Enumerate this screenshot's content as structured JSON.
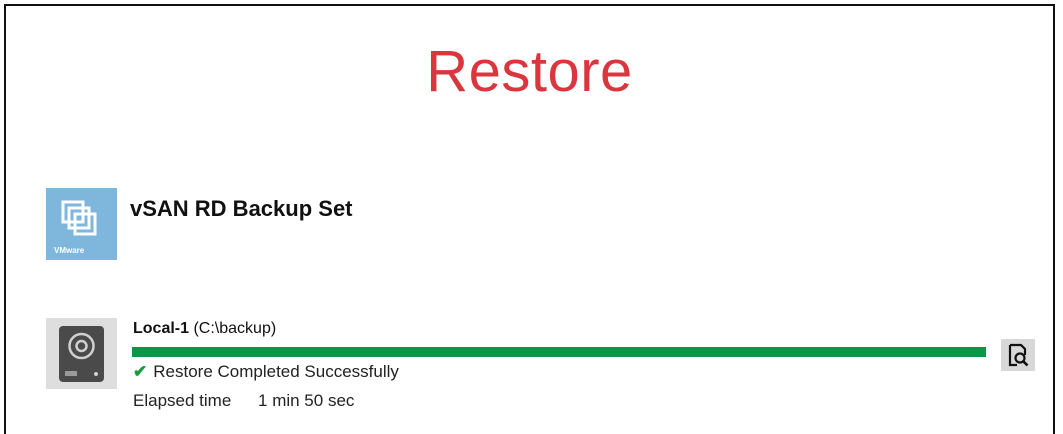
{
  "title": "Restore",
  "colors": {
    "title": "#d9363e",
    "progress": "#0a9644",
    "check": "#1a9a3a",
    "vmware_icon": "#7fb6dc"
  },
  "backup_set": {
    "icon": "vmware-icon",
    "icon_caption": "VMware",
    "name": "vSAN RD Backup Set"
  },
  "destination": {
    "icon": "hard-drive-icon",
    "name": "Local-1",
    "path": "(C:\\backup)",
    "progress": 1.0,
    "status_icon": "check-icon",
    "status": "Restore Completed Successfully",
    "elapsed_label": "Elapsed time",
    "elapsed_value": "1 min 50 sec",
    "log_icon": "view-log-icon"
  }
}
